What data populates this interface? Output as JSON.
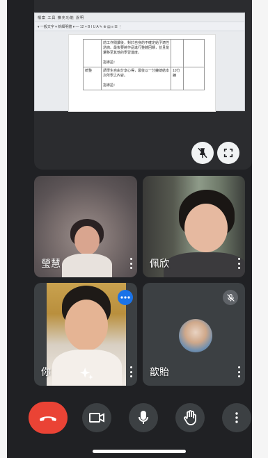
{
  "screen_share": {
    "doc_menu": "檔案 工具 擴充功能 說明",
    "doc_toolbar": "▾ 一般文字 ▾ 新細明體 ▾ — 12 + B I U A ✎ ⊕ ▤ ≡ ☰ ⋮",
    "table_rows": [
      {
        "col1": "",
        "col2": "前工作閱讀後，對於自身的不確定給予適性諮詢。最後要將作品進行整體回饋，並且能遷移至其他的學習進度。\n\n指導語：",
        "col3": "",
        "col4": ""
      },
      {
        "col1": "統整",
        "col2": "請學生自由分享心得，最後以一分鐘總結本次所學之內容。\n\n指導語：",
        "col3": "10分鐘",
        "col4": ""
      }
    ],
    "side_marker": "◇ ●"
  },
  "participants": [
    {
      "name": "瑩慧"
    },
    {
      "name": "佩欣"
    },
    {
      "name": "你"
    },
    {
      "name": "歆貽"
    }
  ],
  "icons": {
    "unpin": "unpin-icon",
    "fullscreen": "fullscreen-icon",
    "more_options": "more-options-icon",
    "effects": "sparkle-effects-icon",
    "muted": "mic-off-icon",
    "end_call": "end-call-icon",
    "camera": "camera-icon",
    "microphone": "microphone-icon",
    "raise_hand": "raise-hand-icon",
    "more": "more-vert-icon"
  },
  "colors": {
    "background": "#202124",
    "tile": "#3c4043",
    "end_call": "#ea4335",
    "accent_blue": "#1a73e8"
  }
}
